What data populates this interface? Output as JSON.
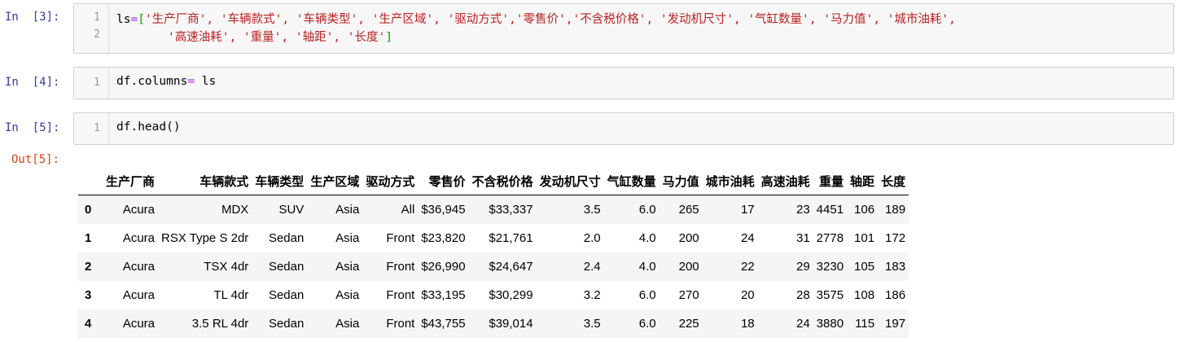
{
  "cells": [
    {
      "prompt": "In  [3]:",
      "lines": [
        "1",
        "2"
      ],
      "code_line1_prefix": "ls",
      "code_line1_op": "=",
      "code_line1_open": "[",
      "code_line1_strings": "'生产厂商', '车辆款式', '车辆类型', '生产区域', '驱动方式','零售价','不含税价格', '发动机尺寸', '气缸数量', '马力值', '城市油耗',",
      "code_line2_strings": "'高速油耗', '重量', '轴距', '长度'",
      "code_line2_close": "]"
    },
    {
      "prompt": "In  [4]:",
      "lines": [
        "1"
      ],
      "code_obj": "df.columns",
      "code_op": "=",
      "code_rest": " ls"
    },
    {
      "prompt": "In  [5]:",
      "lines": [
        "1"
      ],
      "code": "df.head()"
    }
  ],
  "output": {
    "prompt": "Out[5]:",
    "columns": [
      "",
      "生产厂商",
      "车辆款式",
      "车辆类型",
      "生产区域",
      "驱动方式",
      "零售价",
      "不含税价格",
      "发动机尺寸",
      "气缸数量",
      "马力值",
      "城市油耗",
      "高速油耗",
      "重量",
      "轴距",
      "长度"
    ],
    "rows": [
      [
        "0",
        "Acura",
        "MDX",
        "SUV",
        "Asia",
        "All",
        "$36,945",
        "$33,337",
        "3.5",
        "6.0",
        "265",
        "17",
        "23",
        "4451",
        "106",
        "189"
      ],
      [
        "1",
        "Acura",
        "RSX Type S 2dr",
        "Sedan",
        "Asia",
        "Front",
        "$23,820",
        "$21,761",
        "2.0",
        "4.0",
        "200",
        "24",
        "31",
        "2778",
        "101",
        "172"
      ],
      [
        "2",
        "Acura",
        "TSX 4dr",
        "Sedan",
        "Asia",
        "Front",
        "$26,990",
        "$24,647",
        "2.4",
        "4.0",
        "200",
        "22",
        "29",
        "3230",
        "105",
        "183"
      ],
      [
        "3",
        "Acura",
        "TL 4dr",
        "Sedan",
        "Asia",
        "Front",
        "$33,195",
        "$30,299",
        "3.2",
        "6.0",
        "270",
        "20",
        "28",
        "3575",
        "108",
        "186"
      ],
      [
        "4",
        "Acura",
        "3.5 RL 4dr",
        "Sedan",
        "Asia",
        "Front",
        "$43,755",
        "$39,014",
        "3.5",
        "6.0",
        "225",
        "18",
        "24",
        "3880",
        "115",
        "197"
      ]
    ]
  },
  "colors": {
    "in_prompt": "#303f9f",
    "out_prompt": "#d84315",
    "string": "#ba2121",
    "operator": "#aa22ff",
    "cell_bg": "#f7f7f7",
    "row_stripe": "#f5f5f5"
  }
}
